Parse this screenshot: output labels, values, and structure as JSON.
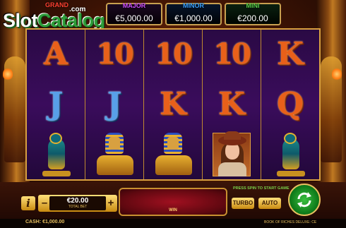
{
  "logo": {
    "text_a": "Slot",
    "text_b": "Catalog",
    "suffix": ".com"
  },
  "jackpots": {
    "grand": {
      "name": "GRAND"
    },
    "major": {
      "name": "MAJOR",
      "value": "€5,000.00"
    },
    "minor": {
      "name": "MINOR",
      "value": "€1,000.00"
    },
    "mini": {
      "name": "MINI",
      "value": "€200.00"
    }
  },
  "reels": [
    [
      {
        "type": "letter",
        "text": "A",
        "color": "red"
      },
      {
        "type": "letter",
        "text": "J",
        "color": "blue"
      },
      {
        "type": "icon",
        "icon": "falcon-icon"
      }
    ],
    [
      {
        "type": "letter",
        "text": "10",
        "color": "red"
      },
      {
        "type": "letter",
        "text": "J",
        "color": "blue"
      },
      {
        "type": "icon",
        "icon": "sphinx-icon"
      }
    ],
    [
      {
        "type": "letter",
        "text": "10",
        "color": "red"
      },
      {
        "type": "letter",
        "text": "K",
        "color": "red"
      },
      {
        "type": "icon",
        "icon": "sphinx-icon"
      }
    ],
    [
      {
        "type": "letter",
        "text": "10",
        "color": "red"
      },
      {
        "type": "letter",
        "text": "K",
        "color": "red"
      },
      {
        "type": "icon",
        "icon": "explorer-woman-icon"
      }
    ],
    [
      {
        "type": "letter",
        "text": "K",
        "color": "red"
      },
      {
        "type": "letter",
        "text": "Q",
        "color": "red"
      },
      {
        "type": "icon",
        "icon": "falcon-icon"
      }
    ]
  ],
  "controls": {
    "info": "i",
    "bet_minus": "–",
    "bet_plus": "+",
    "bet_value": "€20.00",
    "bet_label": "TOTAL BET",
    "win_label": "WIN",
    "press_spin": "PRESS SPIN TO START GAME",
    "turbo": "TURBO",
    "auto": "AUTO"
  },
  "footer": {
    "cash": "CASH: €1,000.00",
    "game_name": "BOOK OF RICHES DELUXE: CE"
  },
  "colors": {
    "accent_gold": "#e8c060",
    "spin_green": "#2ea83a",
    "reel_bg": "#3a0c5c",
    "win_red": "#a01020"
  }
}
